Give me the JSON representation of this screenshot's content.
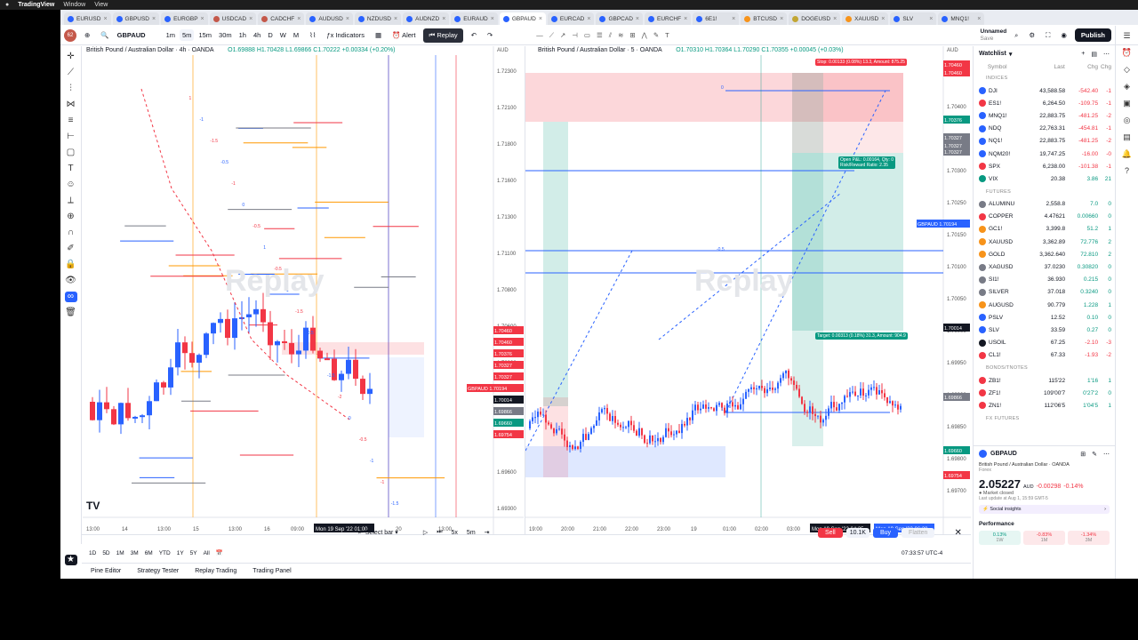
{
  "os": {
    "apple": "",
    "app": "TradingView",
    "menus": [
      "Window",
      "View"
    ]
  },
  "tabs": [
    {
      "label": "EURUSD",
      "color": "#2962ff"
    },
    {
      "label": "GBPUSD",
      "color": "#2962ff"
    },
    {
      "label": "EURGBP",
      "color": "#2962ff"
    },
    {
      "label": "USDCAD",
      "color": "#c4584a"
    },
    {
      "label": "CADCHF",
      "color": "#c4584a"
    },
    {
      "label": "AUDUSD",
      "color": "#2962ff"
    },
    {
      "label": "NZDUSD",
      "color": "#2962ff"
    },
    {
      "label": "AUDNZD",
      "color": "#2962ff"
    },
    {
      "label": "EURAUD",
      "color": "#2962ff"
    },
    {
      "label": "GBPAUD",
      "color": "#2962ff",
      "active": true
    },
    {
      "label": "EURCAD",
      "color": "#2962ff"
    },
    {
      "label": "GBPCAD",
      "color": "#2962ff"
    },
    {
      "label": "EURCHF",
      "color": "#2962ff"
    },
    {
      "label": "6E1!",
      "color": "#2962ff"
    },
    {
      "label": "BTCUSD",
      "color": "#f7931a"
    },
    {
      "label": "DOGEUSD",
      "color": "#c2a633"
    },
    {
      "label": "XAUUSD",
      "color": "#f7931a"
    },
    {
      "label": "SLV",
      "color": "#2962ff"
    },
    {
      "label": "MNQ1!",
      "color": "#2962ff"
    }
  ],
  "toolbar": {
    "symbol": "GBPAUD",
    "avatar": "62",
    "intervals": [
      "1m",
      "5m",
      "15m",
      "30m",
      "1h",
      "4h",
      "D",
      "W",
      "M"
    ],
    "indicators": "Indicators",
    "alert": "Alert",
    "replay": "Replay",
    "layout_name": "Unnamed",
    "layout_sub": "Save",
    "publish": "Publish"
  },
  "left_chart": {
    "title": "British Pound / Australian Dollar · 4h · OANDA",
    "ohlc": "O1.69888 H1.70428 L1.69866 C1.70222 +0.00334 (+0.20%)",
    "currency": "AUD",
    "watermark": "Replay",
    "x_labels": [
      "13:00",
      "14",
      "13:00",
      "15",
      "13:00",
      "16",
      "09:00",
      "Mon 19 Sep '22  01:00",
      "20",
      "13:00"
    ],
    "y_labels": [
      "1.72300",
      "1.72100",
      "1.71800",
      "1.71600",
      "1.71300",
      "1.71100",
      "1.70800",
      "1.70600",
      "1.70300",
      "1.70100",
      "1.69800",
      "1.69600",
      "1.69300"
    ],
    "fib_labels": [
      "1",
      "-1",
      "-1.5",
      "-0.5",
      "-1",
      "0",
      "-0.5",
      "1",
      "-0.5",
      "-1",
      "-1.5",
      "-0.5",
      "-1",
      "-1.5",
      "-2",
      "0",
      "-0.5",
      "-1",
      "-1",
      "-1.5"
    ],
    "price_tags": [
      {
        "text": "1.70460",
        "color": "#f23645"
      },
      {
        "text": "1.70460",
        "color": "#f23645"
      },
      {
        "text": "1.70376",
        "color": "#f23645"
      },
      {
        "text": "1.70327",
        "color": "#f23645"
      },
      {
        "text": "1.70327",
        "color": "#f23645"
      },
      {
        "text": "GBPAUD 1.70194",
        "color": "#f23645"
      },
      {
        "text": "1.70014",
        "color": "#131722"
      },
      {
        "text": "1.69866",
        "color": "#787b86"
      },
      {
        "text": "1.69660",
        "color": "#089981"
      },
      {
        "text": "1.69754",
        "color": "#f23645"
      }
    ]
  },
  "right_chart": {
    "title": "British Pound / Australian Dollar · 5 · OANDA",
    "ohlc": "O1.70310 H1.70364 L1.70290 C1.70355 +0.00045 (+0.03%)",
    "currency": "AUD",
    "watermark": "Replay",
    "stop_label": "Stop: 0.00133 (0.08%) 13.3, Amount: 875.25",
    "pnl_label": "Open P&L: 0.00164, Qty: 0",
    "rr_label": "Risk/Reward Ratio: 2.35",
    "target_label": "Target: 0.00313 (0.18%) 31.3, Amount: 904.9",
    "x_labels": [
      "19:00",
      "20:00",
      "21:00",
      "22:00",
      "23:00",
      "19",
      "01:00",
      "02:00",
      "03:00",
      "Mon 19 Sep '22  04:35",
      "Mon 19 Sep '22  06:30"
    ],
    "y_labels": [
      "1.70400",
      "1.70350",
      "1.70300",
      "1.70250",
      "1.70150",
      "1.70100",
      "1.70050",
      "1.70000",
      "1.69950",
      "1.69900",
      "1.69850",
      "1.69800",
      "1.69700"
    ],
    "fib_labels": [
      "0",
      "-0.5",
      "1"
    ],
    "price_tags": [
      {
        "text": "1.70460",
        "color": "#f23645"
      },
      {
        "text": "1.70460",
        "color": "#f23645"
      },
      {
        "text": "1.70376",
        "color": "#089981"
      },
      {
        "text": "1.70327",
        "color": "#787b86"
      },
      {
        "text": "1.70327",
        "color": "#787b86"
      },
      {
        "text": "1.70327",
        "color": "#787b86"
      },
      {
        "text": "GBPAUD 1.70194",
        "color": "#2962ff"
      },
      {
        "text": "1.70014",
        "color": "#131722"
      },
      {
        "text": "1.69866",
        "color": "#787b86"
      },
      {
        "text": "1.69660",
        "color": "#089981"
      },
      {
        "text": "1.69754",
        "color": "#f23645"
      }
    ]
  },
  "replay_bar": {
    "select_bar": "Select bar",
    "speed": "5x",
    "interval": "5m",
    "sell": "Sell",
    "qty": "10.1K",
    "buy": "Buy",
    "flatten": "Flatten"
  },
  "ranges": [
    "1D",
    "5D",
    "1M",
    "3M",
    "6M",
    "YTD",
    "1Y",
    "5Y",
    "All"
  ],
  "clock": "07:33:57 UTC-4",
  "footer_tabs": [
    "Pine Editor",
    "Strategy Tester",
    "Replay Trading",
    "Trading Panel"
  ],
  "watchlist": {
    "title": "Watchlist",
    "cols": [
      "Symbol",
      "Last",
      "Chg",
      "Chg%"
    ],
    "sections": [
      {
        "name": "INDICES",
        "rows": [
          {
            "sym": "DJI",
            "last": "43,588.58",
            "chg": "-542.40",
            "pct": "-1",
            "color": "#2962ff",
            "dir": "neg"
          },
          {
            "sym": "ES1!",
            "last": "6,264.50",
            "chg": "-109.75",
            "pct": "-1",
            "color": "#f23645",
            "dir": "neg"
          },
          {
            "sym": "MNQ1!",
            "last": "22,883.75",
            "chg": "-481.25",
            "pct": "-2",
            "color": "#2962ff",
            "dir": "neg"
          },
          {
            "sym": "NDQ",
            "last": "22,763.31",
            "chg": "-454.81",
            "pct": "-1",
            "color": "#2962ff",
            "dir": "neg"
          },
          {
            "sym": "NQ1!",
            "last": "22,883.75",
            "chg": "-481.25",
            "pct": "-2",
            "color": "#2962ff",
            "dir": "neg"
          },
          {
            "sym": "NQM20!",
            "last": "19,747.25",
            "chg": "-16.00",
            "pct": "-0",
            "color": "#2962ff",
            "dir": "neg"
          },
          {
            "sym": "SPX",
            "last": "6,238.00",
            "chg": "-101.38",
            "pct": "-1",
            "color": "#f23645",
            "dir": "neg"
          },
          {
            "sym": "VIX",
            "last": "20.38",
            "chg": "3.86",
            "pct": "21",
            "color": "#089981",
            "dir": "pos"
          }
        ]
      },
      {
        "name": "FUTURES",
        "rows": [
          {
            "sym": "ALUMINU",
            "last": "2,558.8",
            "chg": "7.0",
            "pct": "0",
            "color": "#787b86",
            "dir": "pos"
          },
          {
            "sym": "COPPER",
            "last": "4.47621",
            "chg": "0.00660",
            "pct": "0",
            "color": "#f23645",
            "dir": "pos"
          },
          {
            "sym": "GC1!",
            "last": "3,399.8",
            "chg": "51.2",
            "pct": "1",
            "color": "#f7931a",
            "dir": "pos"
          },
          {
            "sym": "XAUUSD",
            "last": "3,362.89",
            "chg": "72.776",
            "pct": "2",
            "color": "#f7931a",
            "dir": "pos"
          },
          {
            "sym": "GOLD",
            "last": "3,362.640",
            "chg": "72.810",
            "pct": "2",
            "color": "#f7931a",
            "dir": "pos"
          },
          {
            "sym": "XAGUSD",
            "last": "37.0230",
            "chg": "0.30820",
            "pct": "0",
            "color": "#787b86",
            "dir": "pos"
          },
          {
            "sym": "SI1!",
            "last": "36.930",
            "chg": "0.215",
            "pct": "0",
            "color": "#787b86",
            "dir": "pos"
          },
          {
            "sym": "SILVER",
            "last": "37.018",
            "chg": "0.3240",
            "pct": "0",
            "color": "#787b86",
            "dir": "pos"
          },
          {
            "sym": "AUGUSD",
            "last": "90.779",
            "chg": "1.228",
            "pct": "1",
            "color": "#f7931a",
            "dir": "pos"
          },
          {
            "sym": "PSLV",
            "last": "12.52",
            "chg": "0.10",
            "pct": "0",
            "color": "#2962ff",
            "dir": "pos"
          },
          {
            "sym": "SLV",
            "last": "33.59",
            "chg": "0.27",
            "pct": "0",
            "color": "#2962ff",
            "dir": "pos"
          },
          {
            "sym": "USOIL",
            "last": "67.25",
            "chg": "-2.10",
            "pct": "-3",
            "color": "#131722",
            "dir": "neg"
          },
          {
            "sym": "CL1!",
            "last": "67.33",
            "chg": "-1.93",
            "pct": "-2",
            "color": "#f23645",
            "dir": "neg"
          }
        ]
      },
      {
        "name": "BONDS/TNOTES",
        "rows": [
          {
            "sym": "ZB1!",
            "last": "115'22",
            "chg": "1'16",
            "pct": "1",
            "color": "#f23645",
            "dir": "pos"
          },
          {
            "sym": "ZF1!",
            "last": "109'00'7",
            "chg": "0'27'2",
            "pct": "0",
            "color": "#f23645",
            "dir": "pos"
          },
          {
            "sym": "ZN1!",
            "last": "112'06'5",
            "chg": "1'04'5",
            "pct": "1",
            "color": "#f23645",
            "dir": "pos"
          }
        ]
      },
      {
        "name": "FX FUTURES",
        "rows": []
      }
    ]
  },
  "detail": {
    "symbol": "GBPAUD",
    "name": "British Pound / Australian Dollar",
    "exchange": "OANDA",
    "type": "Forex",
    "price": "2.05227",
    "currency": "AUD",
    "change": "-0.00298",
    "change_pct": "-0.14%",
    "status": "Market closed",
    "updated": "Last update at Aug 1, 15:59 GMT-5",
    "insights": "Social insights",
    "performance_title": "Performance",
    "performance": [
      {
        "value": "0.13%",
        "period": "1W",
        "dir": "pos"
      },
      {
        "value": "-0.83%",
        "period": "1M",
        "dir": "neg"
      },
      {
        "value": "-1.34%",
        "period": "3M",
        "dir": "neg"
      }
    ]
  }
}
